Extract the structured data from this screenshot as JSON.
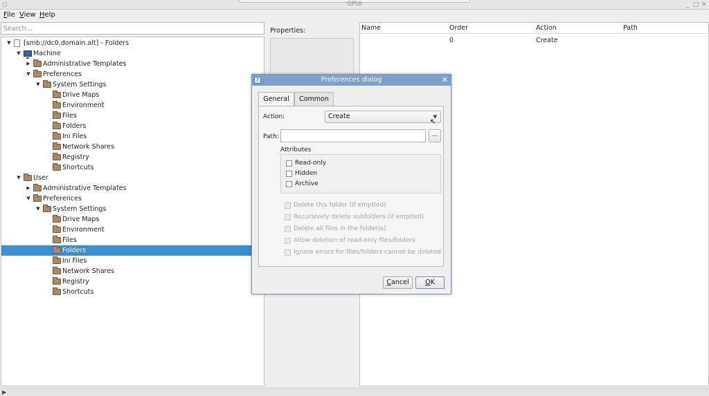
{
  "window": {
    "title": "GPUI"
  },
  "menu": [
    {
      "label": "File",
      "mnemonic": "F",
      "rest": "ile"
    },
    {
      "label": "View",
      "mnemonic": "V",
      "rest": "iew"
    },
    {
      "label": "Help",
      "mnemonic": "H",
      "rest": "elp"
    }
  ],
  "search": {
    "placeholder": "Search..."
  },
  "tree": [
    {
      "label": "[smb://dc0.domain.alt] - Folders",
      "depth": 0,
      "icon": "document-icon",
      "expanded": true
    },
    {
      "label": "Machine",
      "depth": 1,
      "icon": "computer-icon",
      "expanded": true
    },
    {
      "label": "Administrative Templates",
      "depth": 2,
      "icon": "folder-icon",
      "expanded": false
    },
    {
      "label": "Preferences",
      "depth": 2,
      "icon": "folder-icon",
      "expanded": true
    },
    {
      "label": "System Settings",
      "depth": 3,
      "icon": "folder-icon",
      "expanded": true
    },
    {
      "label": "Drive Maps",
      "depth": 4,
      "icon": "folder-icon"
    },
    {
      "label": "Environment",
      "depth": 4,
      "icon": "folder-icon"
    },
    {
      "label": "Files",
      "depth": 4,
      "icon": "folder-icon"
    },
    {
      "label": "Folders",
      "depth": 4,
      "icon": "folder-icon"
    },
    {
      "label": "Ini Files",
      "depth": 4,
      "icon": "folder-icon"
    },
    {
      "label": "Network Shares",
      "depth": 4,
      "icon": "folder-icon"
    },
    {
      "label": "Registry",
      "depth": 4,
      "icon": "folder-icon"
    },
    {
      "label": "Shortcuts",
      "depth": 4,
      "icon": "folder-icon"
    },
    {
      "label": "User",
      "depth": 1,
      "icon": "folder-icon",
      "expanded": true
    },
    {
      "label": "Administrative Templates",
      "depth": 2,
      "icon": "folder-icon",
      "expanded": false
    },
    {
      "label": "Preferences",
      "depth": 2,
      "icon": "folder-icon",
      "expanded": true
    },
    {
      "label": "System Settings",
      "depth": 3,
      "icon": "folder-icon",
      "expanded": true
    },
    {
      "label": "Drive Maps",
      "depth": 4,
      "icon": "folder-icon"
    },
    {
      "label": "Environment",
      "depth": 4,
      "icon": "folder-icon"
    },
    {
      "label": "Files",
      "depth": 4,
      "icon": "folder-icon"
    },
    {
      "label": "Folders",
      "depth": 4,
      "icon": "folder-icon",
      "selected": true
    },
    {
      "label": "Ini Files",
      "depth": 4,
      "icon": "folder-icon"
    },
    {
      "label": "Network Shares",
      "depth": 4,
      "icon": "folder-icon"
    },
    {
      "label": "Registry",
      "depth": 4,
      "icon": "folder-icon"
    },
    {
      "label": "Shortcuts",
      "depth": 4,
      "icon": "folder-icon"
    }
  ],
  "properties": {
    "label": "Properties:"
  },
  "table": {
    "columns": [
      "Name",
      "Order",
      "Action",
      "Path"
    ],
    "rows": [
      {
        "name": "",
        "order": "0",
        "action": "Create",
        "path": ""
      }
    ]
  },
  "dialog": {
    "title": "Preferences dialog",
    "tabs": [
      "General",
      "Common"
    ],
    "active_tab": "General",
    "action_label": "Action:",
    "action_value": "Create",
    "path_label": "Path:",
    "path_value": "",
    "browse_label": "...",
    "attributes_label": "Attributes",
    "attributes": [
      {
        "label": "Read-only",
        "checked": false
      },
      {
        "label": "Hidden",
        "checked": false
      },
      {
        "label": "Archive",
        "checked": false
      }
    ],
    "options": [
      {
        "label": "Delete this folder (if emptied)",
        "enabled": false
      },
      {
        "label": "Recursively delete subfolders (if emptied)",
        "enabled": false
      },
      {
        "label": "Delete all files in the folder(s)",
        "enabled": false
      },
      {
        "label": "Allow deletion of read-only files/folders",
        "enabled": false
      },
      {
        "label": "Ignore errors for files/folders cannot be deleted",
        "enabled": false
      }
    ],
    "cancel_label": "Cancel",
    "cancel_mnemonic": "C",
    "cancel_rest": "ancel",
    "ok_label": "OK",
    "ok_mnemonic": "O",
    "ok_rest": "K"
  },
  "colors": {
    "selection": "#3b8ed0",
    "dialog_titlebar": "#7f9fc6",
    "folder": "#a58a6b"
  }
}
